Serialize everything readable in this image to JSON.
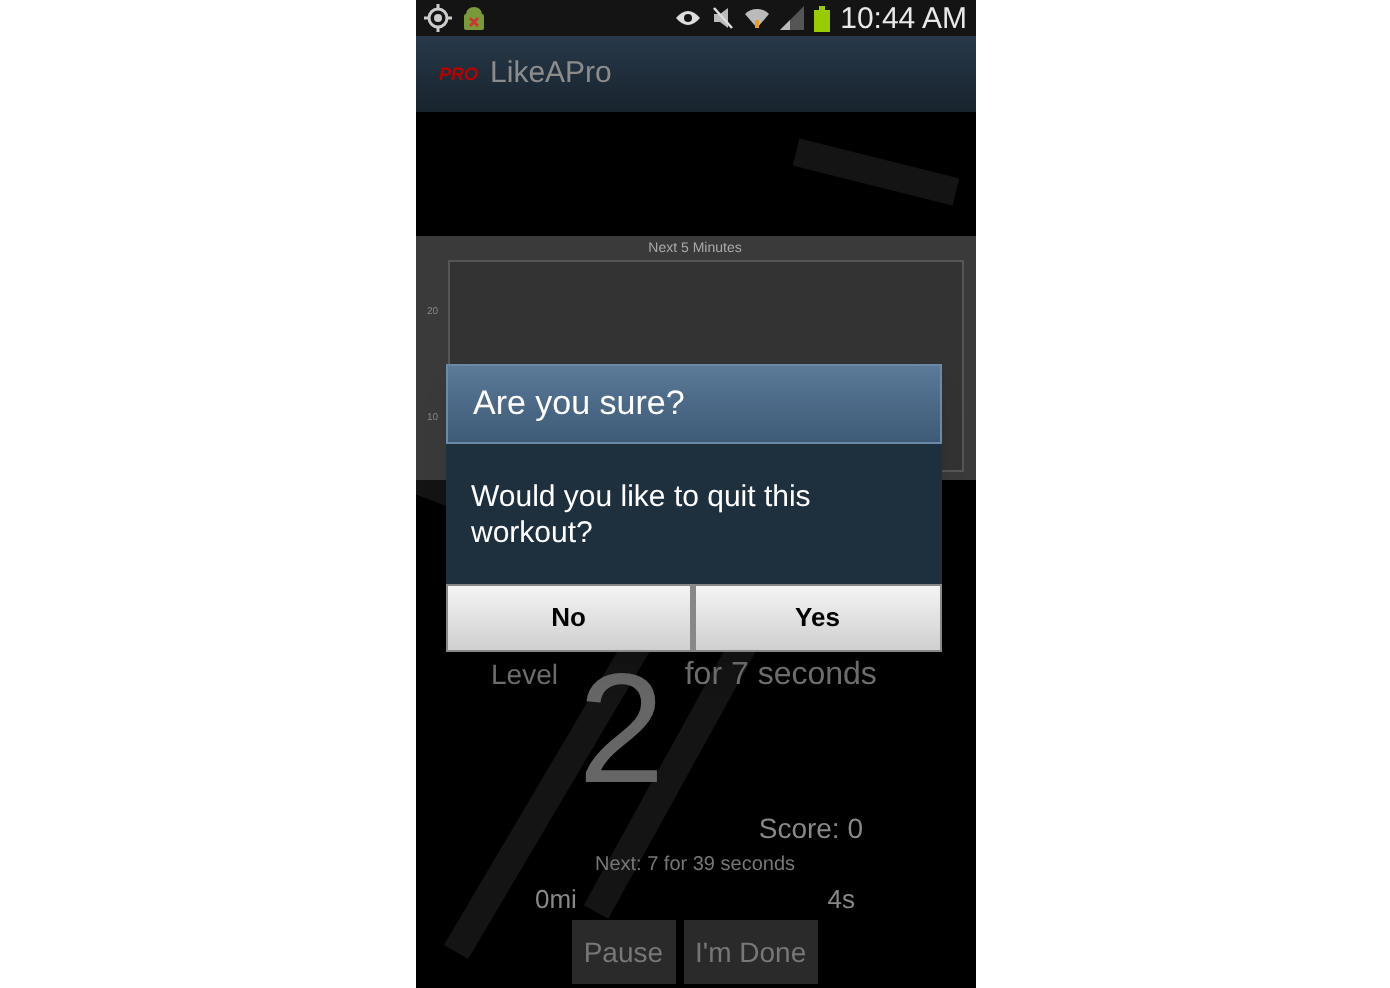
{
  "status_bar": {
    "time": "10:44 AM"
  },
  "action_bar": {
    "logo": "PRO",
    "title": "LikeAPro"
  },
  "chart": {
    "title": "Next 5 Minutes",
    "y_labels": [
      "20",
      "10"
    ]
  },
  "workout": {
    "level_label": "Level",
    "level": "2",
    "duration": "for 7 seconds",
    "score": "Score: 0",
    "next": "Next: 7 for 39 seconds",
    "distance": "0mi",
    "elapsed": "4s"
  },
  "controls": [
    {
      "label": "Pause"
    },
    {
      "label": "I'm Done"
    }
  ],
  "dialog": {
    "title": "Are you sure?",
    "message": "Would you like to quit this workout?",
    "buttons": [
      {
        "label": "No"
      },
      {
        "label": "Yes"
      }
    ]
  }
}
